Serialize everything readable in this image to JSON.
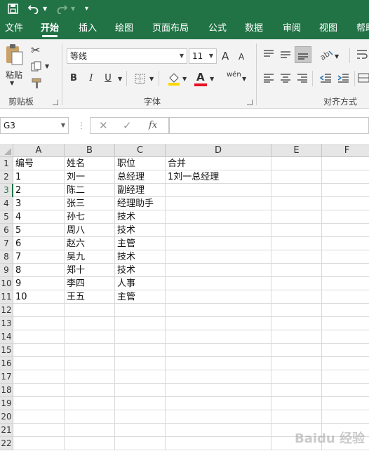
{
  "quick_access": {
    "save_icon": "save-icon",
    "undo_icon": "undo-icon",
    "redo_icon": "redo-icon",
    "customize_icon": "customize-icon"
  },
  "tabs": [
    "文件",
    "开始",
    "插入",
    "绘图",
    "页面布局",
    "公式",
    "数据",
    "审阅",
    "视图",
    "帮助"
  ],
  "active_tab": "开始",
  "ribbon": {
    "paste_label": "粘贴",
    "clipboard_label": "剪贴板",
    "font_name": "等线",
    "font_size": "11",
    "font_group_label": "字体",
    "align_group_label": "对齐方式",
    "bold": "B",
    "italic": "I",
    "underline": "U",
    "grow_font": "A",
    "shrink_font": "A",
    "phonetic": "wén",
    "font_color_letter": "A"
  },
  "formula_bar": {
    "name_box": "G3",
    "cancel": "✕",
    "enter": "✓",
    "fx": "fx",
    "formula": ""
  },
  "sheet": {
    "columns": [
      "A",
      "B",
      "C",
      "D",
      "E",
      "F"
    ],
    "row_numbers": [
      "1",
      "2",
      "3",
      "4",
      "5",
      "6",
      "7",
      "8",
      "9",
      "10",
      "11",
      "12",
      "13",
      "14",
      "15",
      "16",
      "17",
      "18",
      "19",
      "20",
      "21",
      "22"
    ],
    "rows": [
      [
        "编号",
        "姓名",
        "职位",
        "合并"
      ],
      [
        "1",
        "刘一",
        "总经理",
        "1刘一总经理"
      ],
      [
        "2",
        "陈二",
        "副经理",
        ""
      ],
      [
        "3",
        "张三",
        "经理助手",
        ""
      ],
      [
        "4",
        "孙七",
        "技术",
        ""
      ],
      [
        "5",
        "周八",
        "技术",
        ""
      ],
      [
        "6",
        "赵六",
        "主管",
        ""
      ],
      [
        "7",
        "吴九",
        "技术",
        ""
      ],
      [
        "8",
        "郑十",
        "技术",
        ""
      ],
      [
        "9",
        "李四",
        "人事",
        ""
      ],
      [
        "10",
        "王五",
        "主管",
        ""
      ]
    ],
    "selected_cell": "G3"
  },
  "watermark": "Baidu 经验",
  "colors": {
    "accent": "#217346",
    "ribbon_bg": "#f3f3f3",
    "header_bg": "#e6e6e6"
  }
}
